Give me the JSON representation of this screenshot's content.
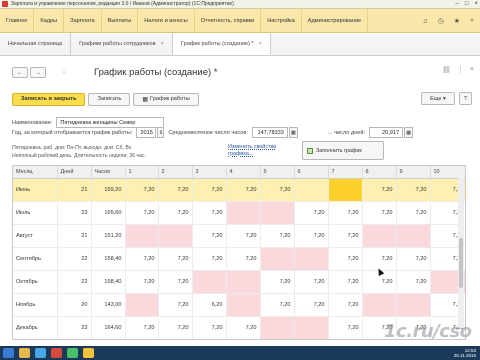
{
  "app": {
    "title": "Зарплата и управление персоналом, редакция 3.0 / Иванов (Администратор) (1С:Предприятие)"
  },
  "menu": [
    "Главное",
    "Кадры",
    "Зарплата",
    "Выплаты",
    "Налоги и взносы",
    "Отчетность, справки",
    "Настройка",
    "Администрирование"
  ],
  "tabs": [
    {
      "label": "Начальная страница"
    },
    {
      "label": "Графики работы сотрудников"
    },
    {
      "label": "График работы (создание) *"
    }
  ],
  "form": {
    "title": "График работы (создание) *",
    "buttons": {
      "save_close": "Записать и закрыть",
      "save": "Записать",
      "schedule": "График работы",
      "more": "Еще",
      "help": "?"
    },
    "name_label": "Наименование:",
    "name_value": "Пятидневка женщины Север",
    "year_label": "Год, за который отображается график работы:",
    "year_value": "2015",
    "avg_hours_label": "Среднемесячное число часов:",
    "avg_hours_value": "147,78333",
    "avg_days_label": "... число дней:",
    "avg_days_value": "20,917",
    "info_line1": "Пятидневка, раб. дни: Пн-Пт, выходн. дни: Сб, Вс",
    "info_line2": "Неполный рабочий день. Длительность недели: 36 час.",
    "link_text": "Изменить свойства графика...",
    "fill_button": "Заполнить график"
  },
  "grid": {
    "columns": [
      "Месяц",
      "Дней",
      "Часов",
      "1",
      "2",
      "3",
      "4",
      "5",
      "6",
      "7",
      "8",
      "9",
      "10"
    ],
    "rows": [
      {
        "month": "Июнь",
        "days": "21",
        "hours": "159,20",
        "cells": [
          "7,20",
          "7,20",
          "7,20",
          "7,20",
          "7,20",
          "",
          "",
          "7,20",
          "7,20",
          "7,20"
        ]
      },
      {
        "month": "Июль",
        "days": "23",
        "hours": "165,60",
        "cells": [
          "7,20",
          "7,20",
          "7,20",
          "",
          "",
          "7,20",
          "7,20",
          "7,20",
          "7,20",
          "7,20"
        ]
      },
      {
        "month": "Август",
        "days": "21",
        "hours": "151,20",
        "cells": [
          "",
          "",
          "7,20",
          "7,20",
          "7,20",
          "7,20",
          "7,20",
          "",
          "",
          "7,20"
        ]
      },
      {
        "month": "Сентябрь",
        "days": "22",
        "hours": "158,40",
        "cells": [
          "7,20",
          "7,20",
          "7,20",
          "7,20",
          "",
          "",
          "7,20",
          "7,20",
          "7,20",
          "7,20"
        ]
      },
      {
        "month": "Октябрь",
        "days": "22",
        "hours": "158,40",
        "cells": [
          "7,20",
          "7,20",
          "",
          "",
          "7,20",
          "7,20",
          "7,20",
          "7,20",
          "7,20",
          ""
        ]
      },
      {
        "month": "Ноябрь",
        "days": "20",
        "hours": "143,00",
        "cells": [
          "",
          "7,20",
          "6,20",
          "",
          "7,20",
          "7,20",
          "7,20",
          "",
          "",
          "7,20"
        ]
      },
      {
        "month": "Декабрь",
        "days": "23",
        "hours": "164,60",
        "cells": [
          "7,20",
          "7,20",
          "7,20",
          "7,20",
          "",
          "",
          "7,20",
          "7,20",
          "7,20",
          "7,20"
        ]
      }
    ]
  },
  "watermark": "1c.ru/cso",
  "clock": {
    "time": "12:53",
    "date": "25.11.2015"
  }
}
